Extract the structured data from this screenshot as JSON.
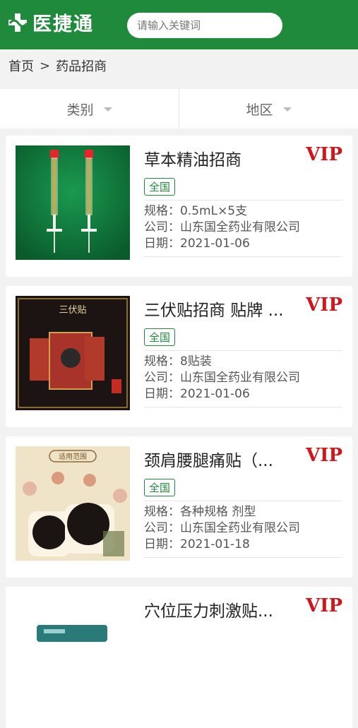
{
  "header": {
    "logo_text": "医捷通",
    "search_placeholder": "请输入关键词"
  },
  "breadcrumb": {
    "home": "首页",
    "separator": ">",
    "current": "药品招商"
  },
  "filters": {
    "category": "类别",
    "region": "地区"
  },
  "labels": {
    "spec": "规格：",
    "company": "公司：",
    "date": "日期："
  },
  "products": [
    {
      "title": "草本精油招商",
      "vip": "VIP",
      "tag": "全国",
      "spec": "0.5mL×5支",
      "company": "山东国全药业有限公司",
      "date": "2021-01-06",
      "image": "syringe-image"
    },
    {
      "title": "三伏贴招商 贴牌 ...",
      "vip": "VIP",
      "tag": "全国",
      "spec": "8贴装",
      "company": "山东国全药业有限公司",
      "date": "2021-01-06",
      "image": "plaster-box-image",
      "image_text": "三伏贴"
    },
    {
      "title": "颈肩腰腿痛贴（...",
      "vip": "VIP",
      "tag": "全国",
      "spec": "各种规格 剂型",
      "company": "山东国全药业有限公司",
      "date": "2021-01-18",
      "image": "pain-patch-image",
      "image_text": "适用范围"
    },
    {
      "title": "穴位压力刺激贴...",
      "vip": "VIP",
      "image": "acupoint-patch-image"
    }
  ],
  "colors": {
    "brand_green": "#1f8a3b",
    "vip_red": "#d0161b"
  }
}
